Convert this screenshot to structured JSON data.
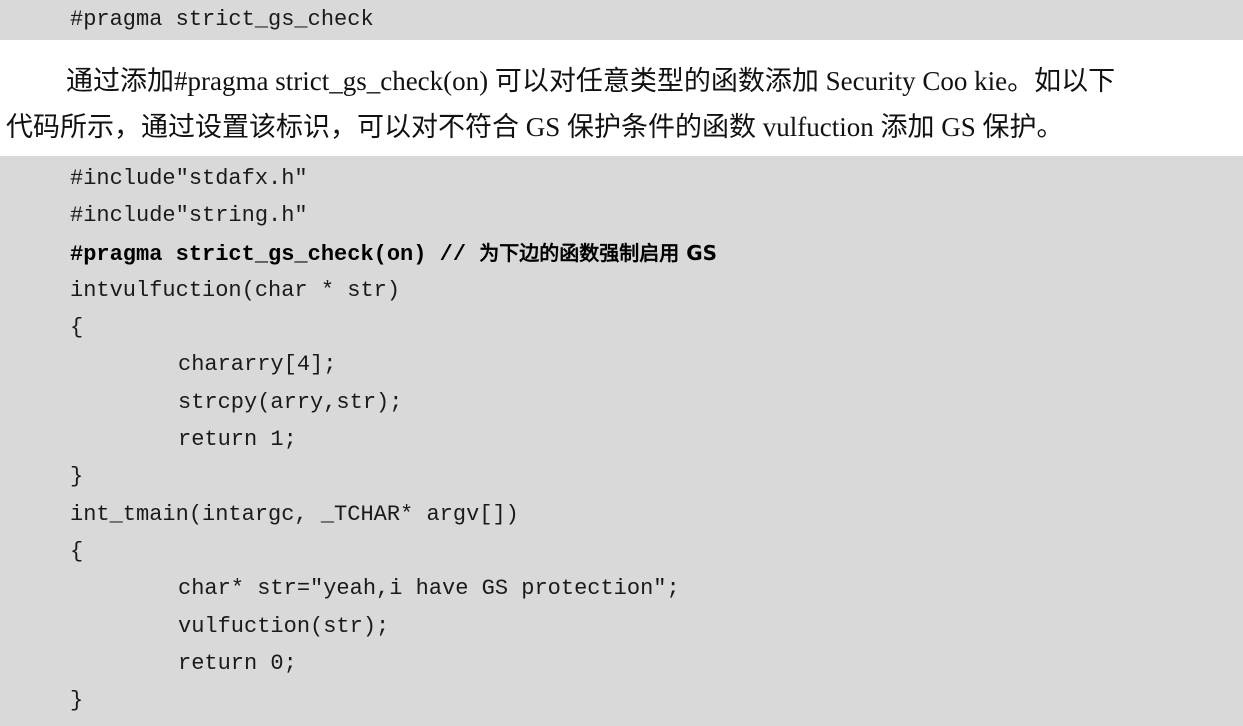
{
  "top_code": {
    "text": "#pragma strict_gs_check"
  },
  "paragraph": {
    "line1": "通过添加#pragma strict_gs_check(on) 可以对任意类型的函数添加 Security Coo kie。如以下",
    "line2": "代码所示，通过设置该标识，可以对不符合 GS 保护条件的函数 vulfuction 添加 GS 保护。"
  },
  "code": {
    "lines": [
      "#include\"stdafx.h\"",
      "#include\"string.h\"",
      "#pragma strict_gs_check(on) // ",
      "intvulfuction(char * str)",
      "{",
      "chararry[4];",
      "strcpy(arry,str);",
      "return 1;",
      "}",
      "int_tmain(intargc, _TCHAR* argv[])",
      "{",
      "char* str=\"yeah,i have GS protection\";",
      "vulfuction(str);",
      "return 0;",
      "}"
    ],
    "pragma_comment": "为下边的函数强制启用 GS"
  }
}
